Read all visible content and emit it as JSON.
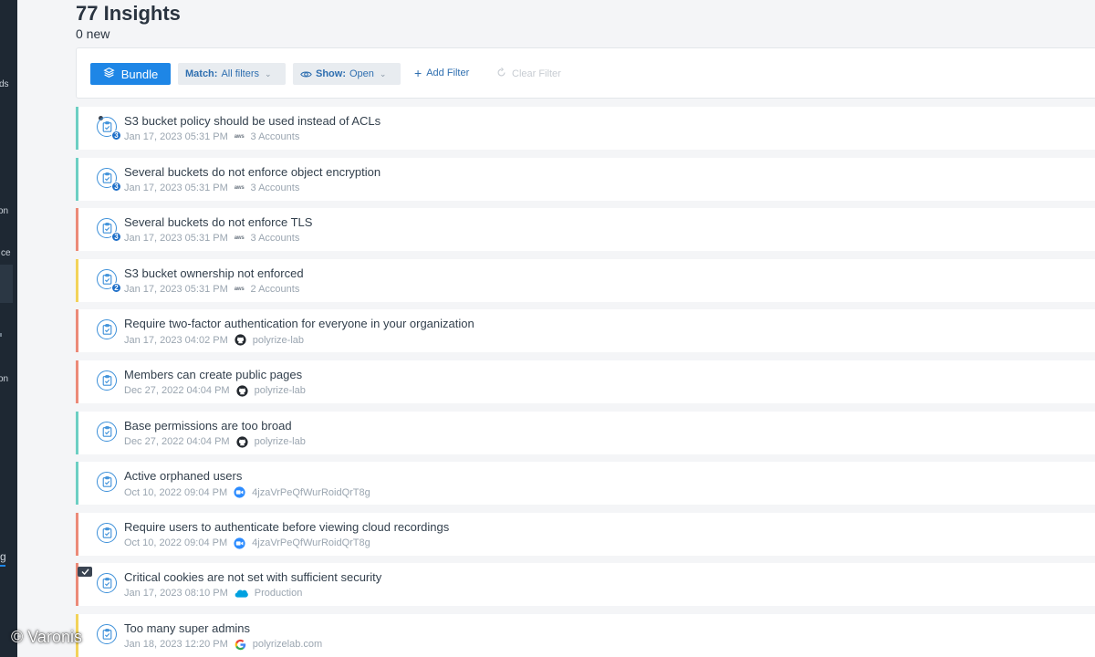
{
  "colors": {
    "accent": "#1e86e6",
    "severity_red": "#ec8a78",
    "severity_teal": "#6ccfc3",
    "severity_yellow": "#f2d35a",
    "sidebar_bg": "#1e2833"
  },
  "sidebar": {
    "fragments": [
      "ds",
      "on",
      "ce",
      "on",
      "g"
    ]
  },
  "header": {
    "title": "77 Insights",
    "subtitle": "0 new"
  },
  "toolbar": {
    "bundle_label": "Bundle",
    "match_key": "Match:",
    "match_value": "All filters",
    "show_key": "Show:",
    "show_value": "Open",
    "add_filter_label": "Add Filter",
    "clear_filter_label": "Clear Filter"
  },
  "insights": [
    {
      "title": "S3 bucket policy should be used instead of ACLs",
      "date": "Jan 17, 2023 05:31 PM",
      "source": "3 Accounts",
      "source_icon": "aws-icon",
      "count": "3",
      "severity": "teal"
    },
    {
      "title": "Several buckets do not enforce object encryption",
      "date": "Jan 17, 2023 05:31 PM",
      "source": "3 Accounts",
      "source_icon": "aws-icon",
      "count": "3",
      "severity": "teal"
    },
    {
      "title": "Several buckets do not enforce TLS",
      "date": "Jan 17, 2023 05:31 PM",
      "source": "3 Accounts",
      "source_icon": "aws-icon",
      "count": "3",
      "severity": "red"
    },
    {
      "title": "S3 bucket ownership not enforced",
      "date": "Jan 17, 2023 05:31 PM",
      "source": "2 Accounts",
      "source_icon": "aws-icon",
      "count": "2",
      "severity": "yellow"
    },
    {
      "title": "Require two-factor authentication for everyone in your organization",
      "date": "Jan 17, 2023 04:02 PM",
      "source": "polyrize-lab",
      "source_icon": "github-icon",
      "severity": "red"
    },
    {
      "title": "Members can create public pages",
      "date": "Dec 27, 2022 04:04 PM",
      "source": "polyrize-lab",
      "source_icon": "github-icon",
      "severity": "red"
    },
    {
      "title": "Base permissions are too broad",
      "date": "Dec 27, 2022 04:04 PM",
      "source": "polyrize-lab",
      "source_icon": "github-icon",
      "severity": "teal"
    },
    {
      "title": "Active orphaned users",
      "date": "Oct 10, 2022 09:04 PM",
      "source": "4jzaVrPeQfWurRoidQrT8g",
      "source_icon": "zoom-icon",
      "severity": "teal"
    },
    {
      "title": "Require users to authenticate before viewing cloud recordings",
      "date": "Oct 10, 2022 09:04 PM",
      "source": "4jzaVrPeQfWurRoidQrT8g",
      "source_icon": "zoom-icon",
      "severity": "red"
    },
    {
      "title": "Critical cookies are not set with sufficient security",
      "date": "Jan 17, 2023 08:10 PM",
      "source": "Production",
      "source_icon": "salesforce-icon",
      "severity": "red"
    },
    {
      "title": "Too many super admins",
      "date": "Jan 18, 2023 12:20 PM",
      "source": "polyrizelab.com",
      "source_icon": "google-icon",
      "severity": "yellow"
    }
  ],
  "watermark": "© Varonis"
}
